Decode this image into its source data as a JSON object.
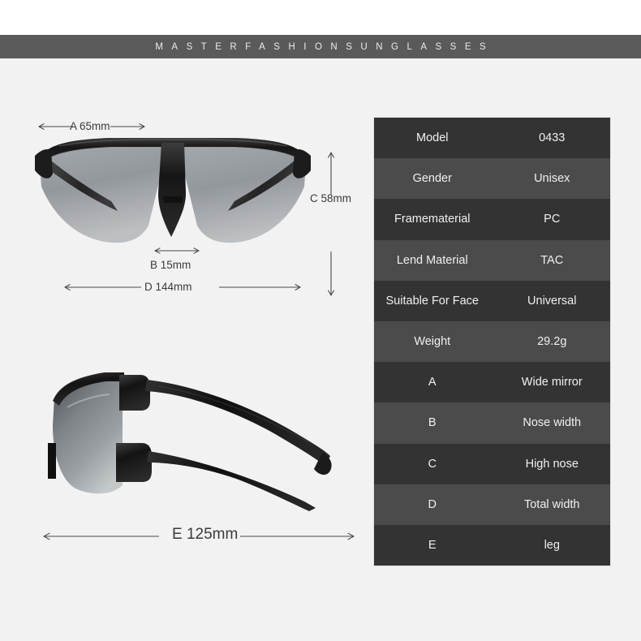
{
  "banner": {
    "brand_text": "MASTERFASHIONSUNGLASSES"
  },
  "dimensions": {
    "a": "A 65mm",
    "b": "B 15mm",
    "c": "C 58mm",
    "d": "D 144mm",
    "e": "E 125mm"
  },
  "product_views": {
    "front_view_alt": "sunglasses-front-view",
    "side_view_alt": "sunglasses-side-view"
  },
  "spec_table": {
    "rows": [
      {
        "key": "Model",
        "value": "0433"
      },
      {
        "key": "Gender",
        "value": "Unisex"
      },
      {
        "key": "Framematerial",
        "value": "PC"
      },
      {
        "key": "Lend Material",
        "value": "TAC"
      },
      {
        "key": "Suitable For Face",
        "value": "Universal"
      },
      {
        "key": "Weight",
        "value": "29.2g"
      },
      {
        "key": "A",
        "value": "Wide mirror"
      },
      {
        "key": "B",
        "value": "Nose width"
      },
      {
        "key": "C",
        "value": "High nose"
      },
      {
        "key": "D",
        "value": "Total width"
      },
      {
        "key": "E",
        "value": "leg"
      }
    ]
  },
  "colors": {
    "background": "#f2f2f2",
    "banner": "#5a5a5a",
    "row_odd": "#333333",
    "row_even": "#4b4b4b",
    "text_light": "#f0f0f0",
    "dim_line": "#4a4a4a"
  }
}
